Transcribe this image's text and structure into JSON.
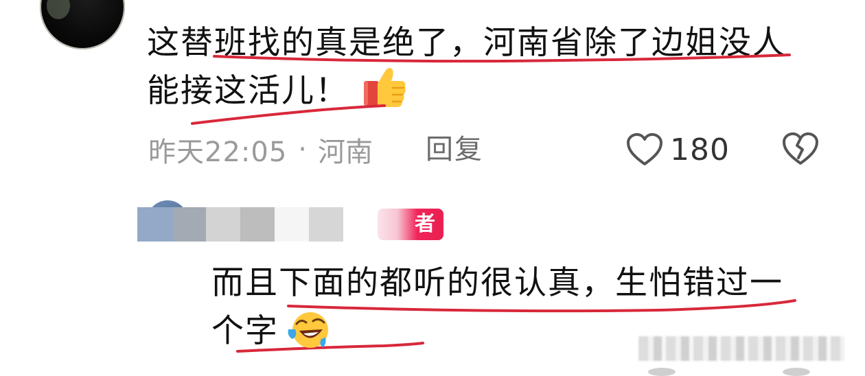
{
  "comment": {
    "line1": "这替班找的真是绝了，河南省除了边姐没人",
    "line2": "能接这活儿！",
    "emoji_icon": "thumbs-up-icon",
    "meta": {
      "time": "昨天22:05",
      "separator": "·",
      "location": "河南"
    },
    "reply_label": "回复",
    "like_count": "180",
    "like_icon": "heart-outline-icon",
    "dislike_icon": "broken-heart-icon"
  },
  "reply": {
    "author_badge": "者",
    "line1": "而且下面的都听的很认真，生怕错过一",
    "line2": "个字",
    "emoji_icon": "laughing-crying-icon"
  },
  "colors": {
    "underline": "#d8283a",
    "author_badge": "#ea1f50",
    "meta_text": "#9a9a9a"
  }
}
